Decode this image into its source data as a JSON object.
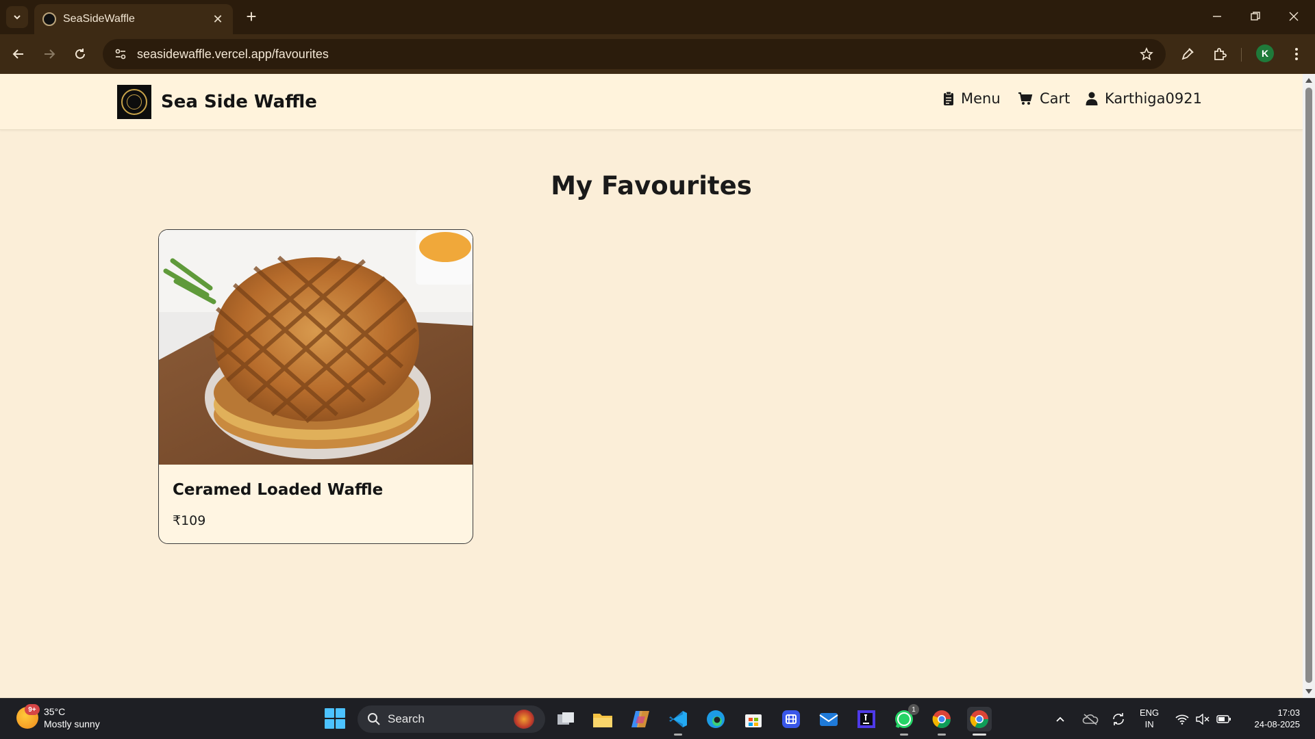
{
  "browser": {
    "tab_title": "SeaSideWaffle",
    "url": "seasidewaffle.vercel.app/favourites",
    "profile_initial": "K"
  },
  "site": {
    "brand": "Sea Side Waffle",
    "nav": [
      {
        "label": "Menu",
        "icon": "clipboard-icon"
      },
      {
        "label": "Cart",
        "icon": "cart-icon"
      },
      {
        "label": "Karthiga0921",
        "icon": "user-icon"
      }
    ]
  },
  "main": {
    "title": "My Favourites",
    "items": [
      {
        "name": "Ceramed Loaded Waffle",
        "price": "₹109",
        "image": "waffle-photo"
      }
    ]
  },
  "taskbar": {
    "weather_temp": "35°C",
    "weather_desc": "Mostly sunny",
    "weather_badge": "9+",
    "search_label": "Search",
    "whatsapp_badge": "1",
    "lang_top": "ENG",
    "lang_bottom": "IN",
    "time": "17:03",
    "date": "24-08-2025"
  },
  "colors": {
    "page_bg": "#fbeed8",
    "header_bg": "#fff3dc",
    "chrome_dark": "#2b1c0c",
    "chrome_mid": "#3d2a14"
  }
}
